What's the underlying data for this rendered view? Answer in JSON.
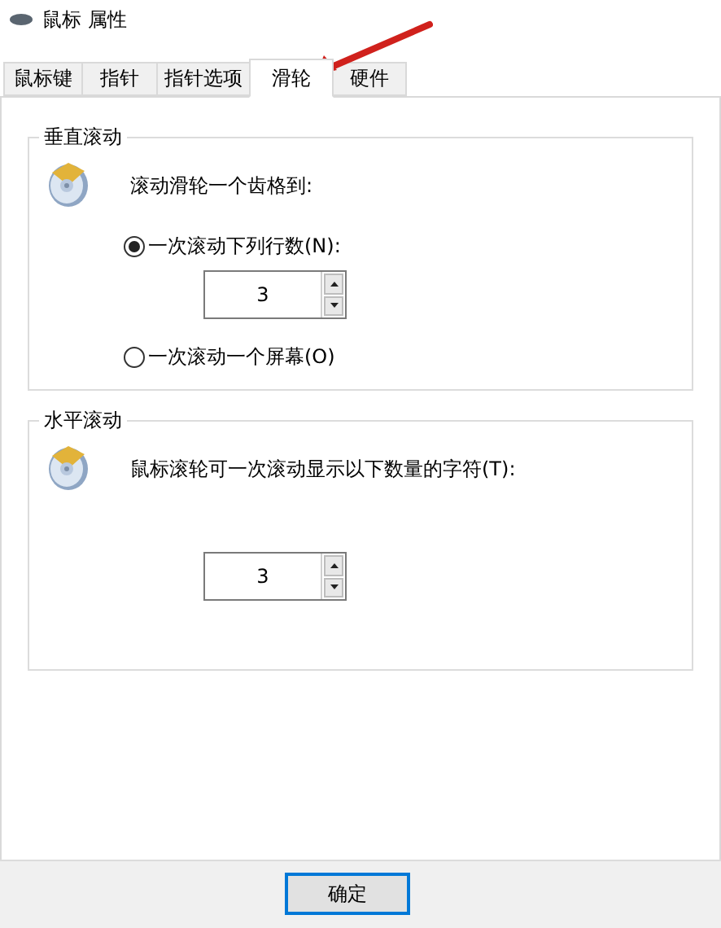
{
  "window": {
    "title": "鼠标 属性"
  },
  "tabs": [
    {
      "label": "鼠标键",
      "selected": false
    },
    {
      "label": "指针",
      "selected": false
    },
    {
      "label": "指针选项",
      "selected": false
    },
    {
      "label": "滑轮",
      "selected": true
    },
    {
      "label": "硬件",
      "selected": false
    }
  ],
  "vertical_scrolling": {
    "title": "垂直滚动",
    "prompt": "滚动滑轮一个齿格到:",
    "options": [
      {
        "label": "一次滚动下列行数(N):",
        "selected": true,
        "spinner": {
          "value": "3"
        }
      },
      {
        "label": "一次滚动一个屏幕(O)",
        "selected": false
      }
    ]
  },
  "horizontal_scrolling": {
    "title": "水平滚动",
    "prompt": "鼠标滚轮可一次滚动显示以下数量的字符(T):",
    "spinner": {
      "value": "3"
    }
  },
  "buttons": [
    "确定"
  ]
}
